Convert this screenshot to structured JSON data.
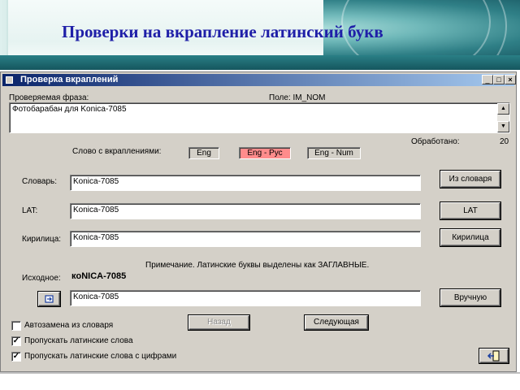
{
  "slide": {
    "title": "Проверки на вкрапление латинский букв"
  },
  "window": {
    "title": "Проверка вкраплений",
    "controls": [
      "_",
      "□",
      "×"
    ]
  },
  "phrase": {
    "label": "Проверяемая фраза:",
    "field_label": "Поле: IM_NOM",
    "value": "Фотобарабан для Konica-7085"
  },
  "processed": {
    "label": "Обработано:",
    "value": "20"
  },
  "word_with_inclusions": {
    "label": "Слово с вкраплениями:",
    "tags": [
      {
        "label": "Eng",
        "active": false
      },
      {
        "label": "Eng - Рус",
        "active": true
      },
      {
        "label": "Eng - Num",
        "active": false
      }
    ]
  },
  "rows": {
    "dictionary": {
      "label": "Словарь:",
      "value": "Konica-7085",
      "button": "Из словаря"
    },
    "lat": {
      "label": "LAT:",
      "value": "Konica-7085",
      "button": "LAT"
    },
    "cyrillic": {
      "label": "Кирилица:",
      "value": "Konica-7085",
      "button": "Кирилица"
    }
  },
  "note": "Примечание. Латинские буквы выделены как ЗАГЛАВНЫЕ.",
  "source": {
    "label": "Исходное:",
    "value": "кoNICA-7085"
  },
  "manual": {
    "value": "Konica-7085",
    "button": "Вручную",
    "icon": "cycle-icon"
  },
  "nav": {
    "back": "Назад",
    "next": "Следующая"
  },
  "checkboxes": [
    {
      "label": "Автозамена из словаря",
      "checked": false
    },
    {
      "label": "Пропускать латинские слова",
      "checked": true
    },
    {
      "label": "Пропускать латинские слова с цифрами",
      "checked": true
    }
  ],
  "exit_icon": "exit-door-icon"
}
